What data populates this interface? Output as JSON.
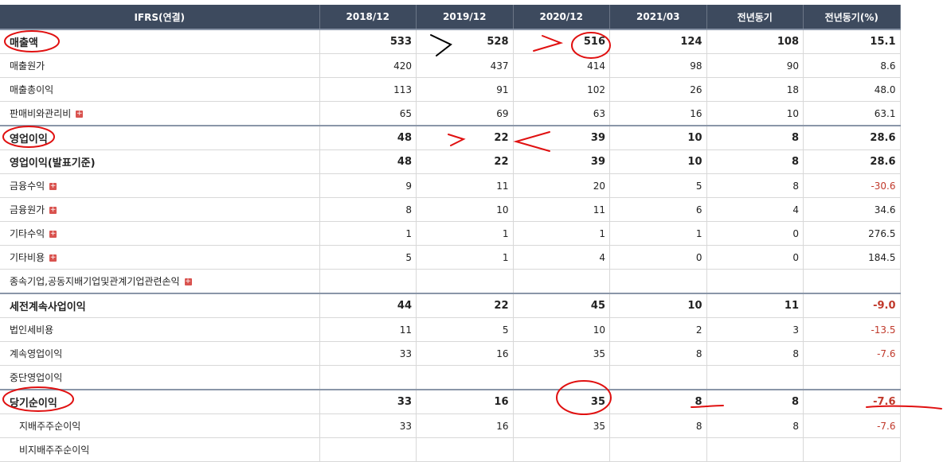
{
  "table": {
    "headers": [
      "IFRS(연결)",
      "2018/12",
      "2019/12",
      "2020/12",
      "2021/03",
      "전년동기",
      "전년동기(%)"
    ],
    "rows": [
      {
        "label": "매출액",
        "values": [
          "533",
          "528",
          "516",
          "124",
          "108",
          "15.1"
        ]
      },
      {
        "label": "매출원가",
        "values": [
          "420",
          "437",
          "414",
          "98",
          "90",
          "8.6"
        ]
      },
      {
        "label": "매출총이익",
        "values": [
          "113",
          "91",
          "102",
          "26",
          "18",
          "48.0"
        ]
      },
      {
        "label": "판매비와관리비",
        "values": [
          "65",
          "69",
          "63",
          "16",
          "10",
          "63.1"
        ]
      },
      {
        "label": "영업이익",
        "values": [
          "48",
          "22",
          "39",
          "10",
          "8",
          "28.6"
        ]
      },
      {
        "label": "영업이익(발표기준)",
        "values": [
          "48",
          "22",
          "39",
          "10",
          "8",
          "28.6"
        ]
      },
      {
        "label": "금융수익",
        "values": [
          "9",
          "11",
          "20",
          "5",
          "8",
          "-30.6"
        ]
      },
      {
        "label": "금융원가",
        "values": [
          "8",
          "10",
          "11",
          "6",
          "4",
          "34.6"
        ]
      },
      {
        "label": "기타수익",
        "values": [
          "1",
          "1",
          "1",
          "1",
          "0",
          "276.5"
        ]
      },
      {
        "label": "기타비용",
        "values": [
          "5",
          "1",
          "4",
          "0",
          "0",
          "184.5"
        ]
      },
      {
        "label": "종속기업,공동지배기업및관계기업관련손익",
        "values": [
          "",
          "",
          "",
          "",
          "",
          ""
        ]
      },
      {
        "label": "세전계속사업이익",
        "values": [
          "44",
          "22",
          "45",
          "10",
          "11",
          "-9.0"
        ]
      },
      {
        "label": "법인세비용",
        "values": [
          "11",
          "5",
          "10",
          "2",
          "3",
          "-13.5"
        ]
      },
      {
        "label": "계속영업이익",
        "values": [
          "33",
          "16",
          "35",
          "8",
          "8",
          "-7.6"
        ]
      },
      {
        "label": "중단영업이익",
        "values": [
          "",
          "",
          "",
          "",
          "",
          ""
        ]
      },
      {
        "label": "당기순이익",
        "values": [
          "33",
          "16",
          "35",
          "8",
          "8",
          "-7.6"
        ]
      },
      {
        "label": "지배주주순이익",
        "values": [
          "33",
          "16",
          "35",
          "8",
          "8",
          "-7.6"
        ]
      },
      {
        "label": "비지배주주순이익",
        "values": [
          "",
          "",
          "",
          "",
          "",
          ""
        ]
      }
    ]
  },
  "colors": {
    "header_bg": "#3d4a5e",
    "negative": "#c0392b",
    "annotation": "#e01010",
    "expand_icon": "#d9534f"
  }
}
